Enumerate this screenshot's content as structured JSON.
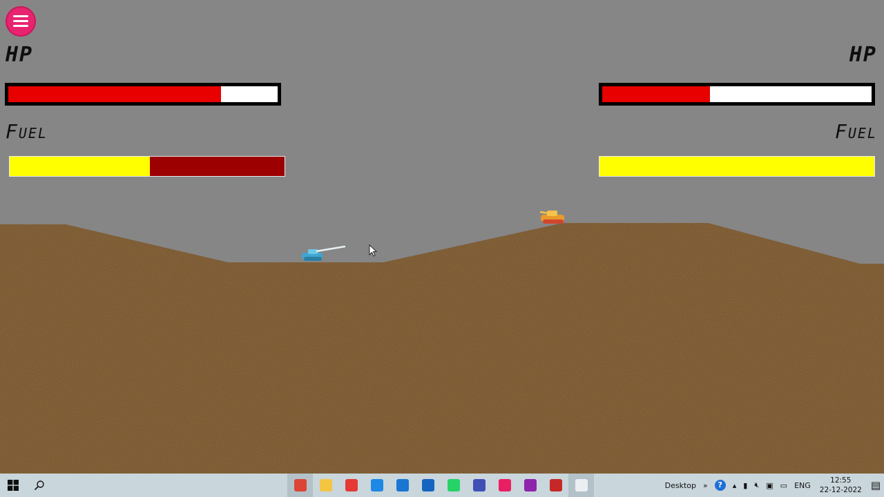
{
  "hud": {
    "left": {
      "hp_label": "HP",
      "fuel_label": "Fuel",
      "hp_fraction": 0.79,
      "fuel_fraction": 0.51
    },
    "right": {
      "hp_label": "HP",
      "fuel_label": "Fuel",
      "hp_fraction": 0.4,
      "fuel_fraction": 1.0
    }
  },
  "colors": {
    "sky": "#868686",
    "ground": "#6e4a24",
    "hp_fill": "#e80000",
    "fuel_fill": "#ffff00",
    "fuel_empty": "#9c0000",
    "menu": "#e8236f",
    "player_tank": "#4fb3d6",
    "enemy_tank": "#f0a830"
  },
  "taskbar": {
    "apps": [
      {
        "name": "chrome-icon",
        "color": "#db4437",
        "active": true
      },
      {
        "name": "file-explorer-icon",
        "color": "#f4c542",
        "active": false
      },
      {
        "name": "app-red-diamond-icon",
        "color": "#e53935",
        "active": false
      },
      {
        "name": "edge-icon",
        "color": "#1e88e5",
        "active": false
      },
      {
        "name": "vscode-icon",
        "color": "#1976d2",
        "active": false
      },
      {
        "name": "mail-icon",
        "color": "#1565c0",
        "active": false
      },
      {
        "name": "whatsapp-icon",
        "color": "#25d366",
        "active": false
      },
      {
        "name": "virtualbox-icon",
        "color": "#3f51b5",
        "active": false
      },
      {
        "name": "intellij-icon",
        "color": "#e91e63",
        "active": false
      },
      {
        "name": "winrar-icon",
        "color": "#8e24aa",
        "active": false
      },
      {
        "name": "record-icon",
        "color": "#c62828",
        "active": false
      },
      {
        "name": "game-window-icon",
        "color": "#eceff1",
        "active": true
      }
    ],
    "desktop_label": "Desktop",
    "language": "ENG",
    "time": "12:55",
    "date": "22-12-2022"
  }
}
